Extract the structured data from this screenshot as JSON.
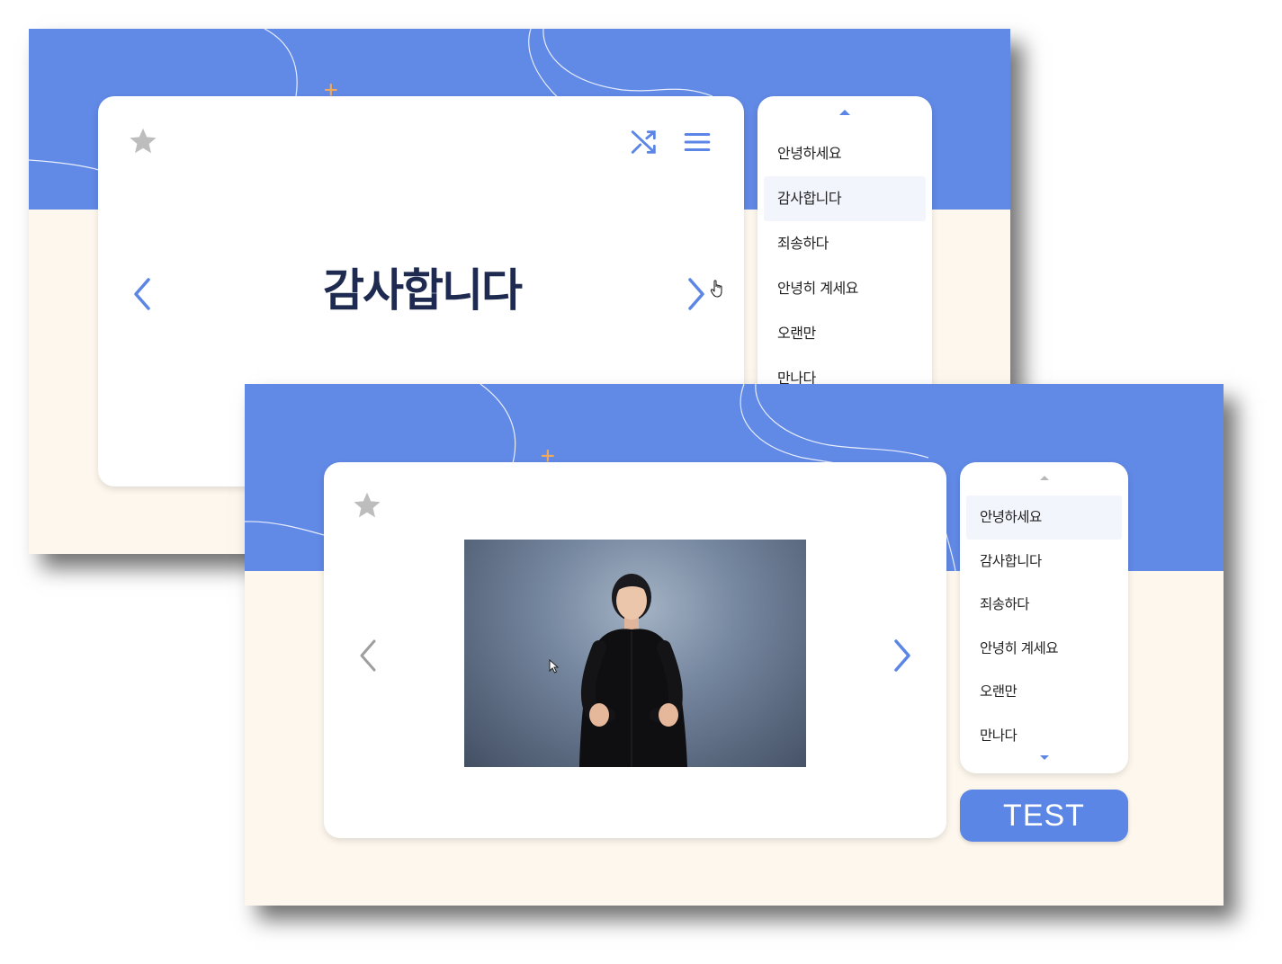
{
  "colors": {
    "blue_band": "#6189e6",
    "cream": "#fdf7ed",
    "accent": "#5b86e5",
    "word_text": "#1e2a4f",
    "star_gray": "#bdbdbd",
    "sparkle_orange": "#f0a95a"
  },
  "back_panel": {
    "card": {
      "word": "감사합니다",
      "icons": [
        "star-icon",
        "shuffle-icon",
        "menu-icon",
        "chevron-left-icon",
        "chevron-right-icon",
        "hand-cursor-icon"
      ]
    },
    "word_list": {
      "items": [
        {
          "label": "안녕하세요"
        },
        {
          "label": "감사합니다"
        },
        {
          "label": "죄송하다"
        },
        {
          "label": "안녕히 계세요"
        },
        {
          "label": "오랜만"
        },
        {
          "label": "만나다"
        }
      ],
      "selected_label": "감사합니다"
    }
  },
  "front_panel": {
    "card": {
      "video_subject": "sign language interpreter",
      "icons": [
        "star-icon",
        "chevron-left-icon",
        "chevron-right-icon",
        "arrow-cursor-icon"
      ]
    },
    "word_list": {
      "items": [
        {
          "label": "안녕하세요"
        },
        {
          "label": "감사합니다"
        },
        {
          "label": "죄송하다"
        },
        {
          "label": "안녕히 계세요"
        },
        {
          "label": "오랜만"
        },
        {
          "label": "만나다"
        }
      ],
      "selected_label": "안녕하세요"
    },
    "test_button": "TEST"
  }
}
